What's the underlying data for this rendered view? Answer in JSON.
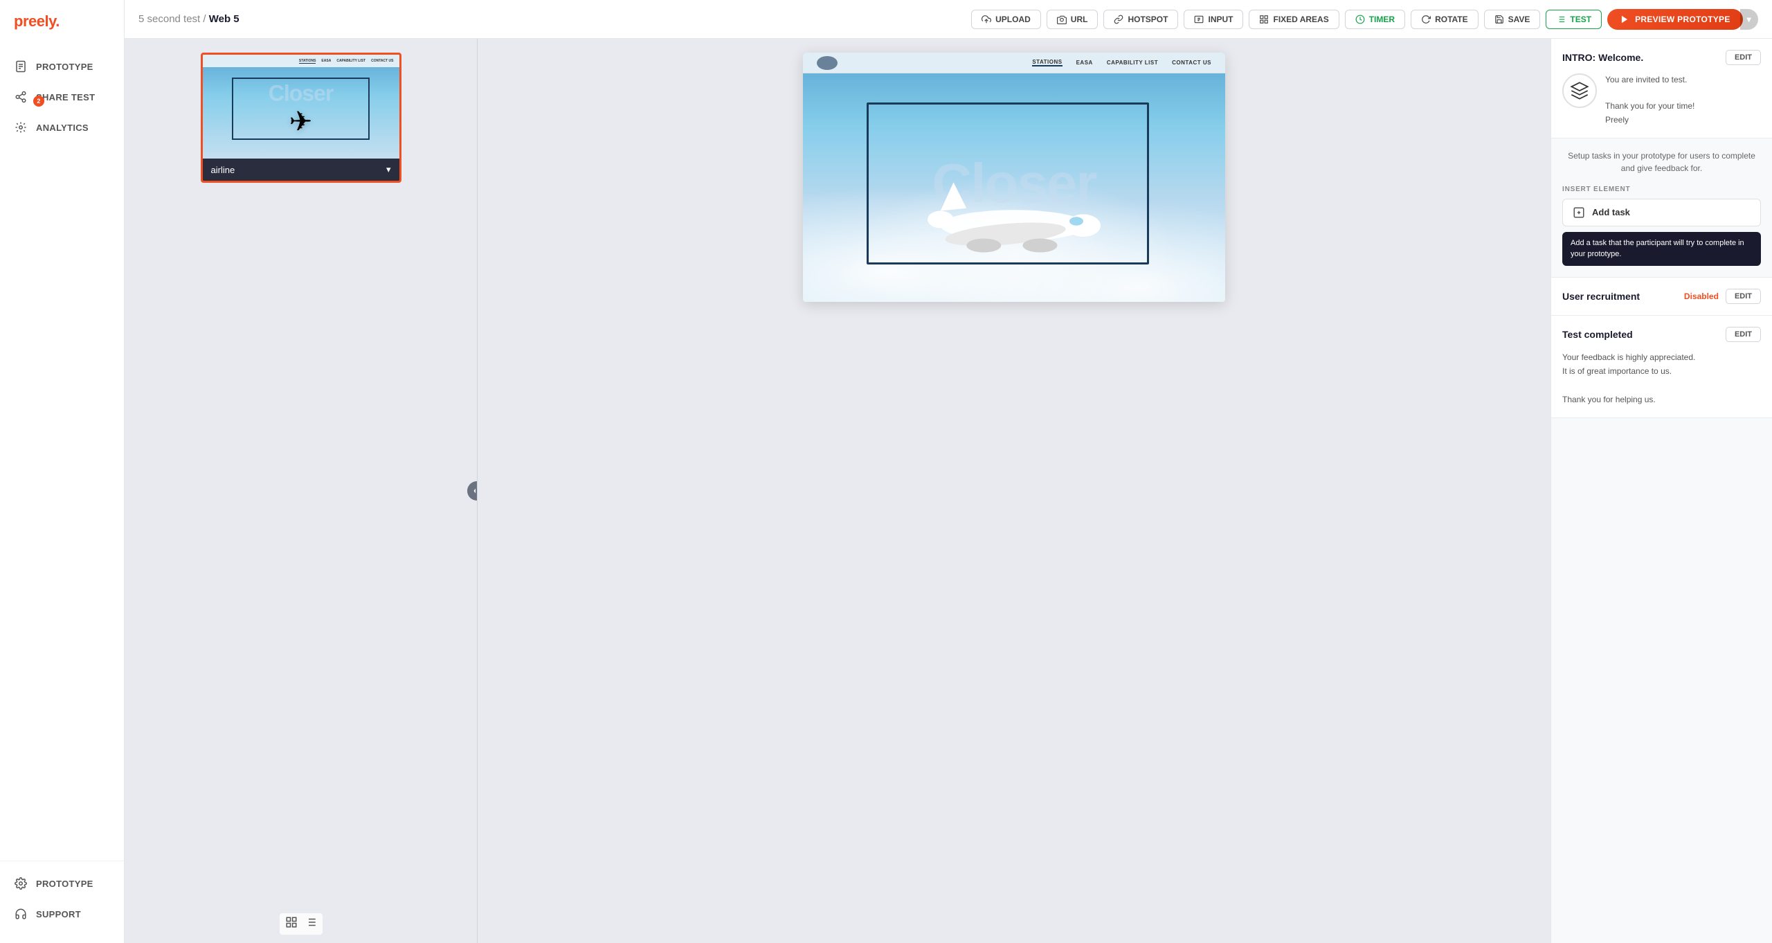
{
  "app": {
    "logo": "preely",
    "logo_dot": "."
  },
  "breadcrumb": {
    "project": "5 second test",
    "separator": " / ",
    "screen": "Web 5"
  },
  "toolbar": {
    "upload_label": "UPLOAD",
    "url_label": "URL",
    "hotspot_label": "HOTSPOT",
    "input_label": "INPUT",
    "fixed_areas_label": "FIXED AREAS",
    "timer_label": "TIMER",
    "rotate_label": "ROTATE",
    "save_label": "SAVE",
    "test_label": "TEST",
    "preview_label": "PREVIEW PROTOTYPE"
  },
  "sidebar": {
    "items": [
      {
        "id": "prototype",
        "label": "PROTOTYPE",
        "icon": "document"
      },
      {
        "id": "share-test",
        "label": "SHARE TEST",
        "icon": "share",
        "badge": "2"
      },
      {
        "id": "analytics",
        "label": "ANALYTICS",
        "icon": "analytics"
      }
    ],
    "bottom": [
      {
        "id": "settings",
        "label": "SETTINGS",
        "icon": "gear"
      },
      {
        "id": "support",
        "label": "SUPPORT",
        "icon": "headphones"
      }
    ]
  },
  "left_panel": {
    "screen_label": "airline",
    "dropdown_icon": "▾"
  },
  "right_panel": {
    "intro": {
      "title": "INTRO: Welcome.",
      "edit_label": "EDIT",
      "body_line1": "You are invited to test.",
      "body_line2": "Thank you for your time!",
      "body_line3": "Preely"
    },
    "tasks": {
      "setup_desc": "Setup tasks in your prototype for users to complete and give feedback for.",
      "insert_element_label": "INSERT ELEMENT",
      "add_task_label": "Add task",
      "tooltip": "Add a task that the participant will try to complete in your prototype."
    },
    "user_recruitment": {
      "title": "User recruitment",
      "status": "Disabled",
      "edit_label": "EDIT"
    },
    "test_completed": {
      "title": "Test completed",
      "edit_label": "EDIT",
      "line1": "Your feedback is highly appreciated.",
      "line2": "It is of great importance to us.",
      "line3": "Thank you for helping us."
    }
  }
}
